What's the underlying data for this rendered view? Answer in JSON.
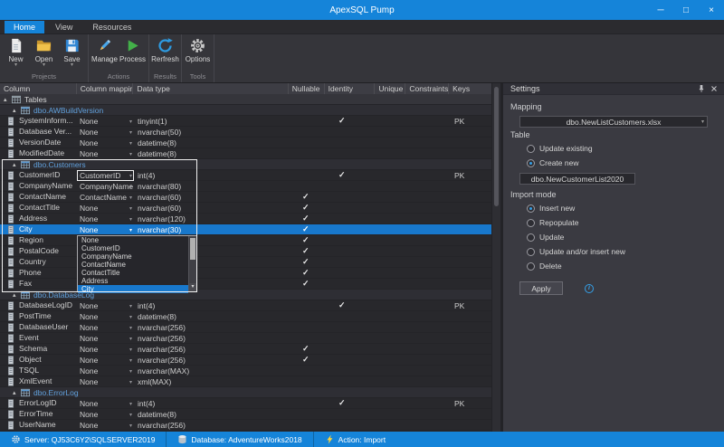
{
  "window": {
    "title": "ApexSQL Pump",
    "controls": {
      "minimize": "─",
      "maximize": "□",
      "close": "×"
    }
  },
  "tabs": [
    {
      "label": "Home",
      "active": true
    },
    {
      "label": "View",
      "active": false
    },
    {
      "label": "Resources",
      "active": false
    }
  ],
  "ribbon": {
    "groups": [
      {
        "label": "Projects",
        "items": [
          {
            "label": "New",
            "icon": "new-document-icon",
            "split": true
          },
          {
            "label": "Open",
            "icon": "open-folder-icon",
            "split": true
          },
          {
            "label": "Save",
            "icon": "save-icon",
            "split": true
          }
        ]
      },
      {
        "label": "Actions",
        "items": [
          {
            "label": "Manage",
            "icon": "manage-pencil-icon",
            "split": false
          },
          {
            "label": "Process",
            "icon": "process-play-icon",
            "split": false
          }
        ]
      },
      {
        "label": "Results",
        "items": [
          {
            "label": "Rerfresh",
            "icon": "refresh-icon",
            "split": false
          }
        ]
      },
      {
        "label": "Tools",
        "items": [
          {
            "label": "Options",
            "icon": "options-gear-icon",
            "split": false
          }
        ]
      }
    ]
  },
  "grid": {
    "columns": [
      "Column",
      "Column mapping",
      "Data type",
      "Nullable",
      "Identity",
      "Unique",
      "Constraints",
      "Keys"
    ],
    "root_label": "Tables",
    "icons": {
      "root": "tables-icon",
      "table": "table-icon",
      "column": "column-icon"
    },
    "tables": [
      {
        "name": "dbo.AWBuildVersion",
        "rows": [
          {
            "column": "SystemInform...",
            "mapping": "None",
            "datatype": "tinyint(1)",
            "nullable": false,
            "identity": true,
            "keys": "PK"
          },
          {
            "column": "Database Ver...",
            "mapping": "None",
            "datatype": "nvarchar(50)",
            "nullable": false,
            "identity": false,
            "keys": ""
          },
          {
            "column": "VersionDate",
            "mapping": "None",
            "datatype": "datetime(8)",
            "nullable": false,
            "identity": false,
            "keys": ""
          },
          {
            "column": "ModifiedDate",
            "mapping": "None",
            "datatype": "datetime(8)",
            "nullable": false,
            "identity": false,
            "keys": ""
          }
        ]
      },
      {
        "name": "dbo.Customers",
        "rows": [
          {
            "column": "CustomerID",
            "mapping": "CustomerID",
            "datatype": "int(4)",
            "nullable": false,
            "identity": true,
            "keys": "PK",
            "outlined": true
          },
          {
            "column": "CompanyName",
            "mapping": "CompanyName",
            "datatype": "nvarchar(80)",
            "nullable": false,
            "identity": false,
            "keys": ""
          },
          {
            "column": "ContactName",
            "mapping": "ContactName",
            "datatype": "nvarchar(60)",
            "nullable": true,
            "identity": false,
            "keys": ""
          },
          {
            "column": "ContactTitle",
            "mapping": "None",
            "datatype": "nvarchar(60)",
            "nullable": true,
            "identity": false,
            "keys": ""
          },
          {
            "column": "Address",
            "mapping": "None",
            "datatype": "nvarchar(120)",
            "nullable": true,
            "identity": false,
            "keys": ""
          },
          {
            "column": "City",
            "mapping": "None",
            "datatype": "nvarchar(30)",
            "nullable": true,
            "identity": false,
            "keys": "",
            "selected": true
          },
          {
            "column": "Region",
            "mapping": "",
            "datatype": "",
            "nullable": true,
            "identity": false,
            "keys": ""
          },
          {
            "column": "PostalCode",
            "mapping": "",
            "datatype": "",
            "nullable": true,
            "identity": false,
            "keys": ""
          },
          {
            "column": "Country",
            "mapping": "",
            "datatype": "",
            "nullable": true,
            "identity": false,
            "keys": ""
          },
          {
            "column": "Phone",
            "mapping": "",
            "datatype": "",
            "nullable": true,
            "identity": false,
            "keys": ""
          },
          {
            "column": "Fax",
            "mapping": "",
            "datatype": "",
            "nullable": true,
            "identity": false,
            "keys": ""
          }
        ]
      },
      {
        "name": "dbo.DatabaseLog",
        "rows": [
          {
            "column": "DatabaseLogID",
            "mapping": "None",
            "datatype": "int(4)",
            "nullable": false,
            "identity": true,
            "keys": "PK"
          },
          {
            "column": "PostTime",
            "mapping": "None",
            "datatype": "datetime(8)",
            "nullable": false,
            "identity": false,
            "keys": ""
          },
          {
            "column": "DatabaseUser",
            "mapping": "None",
            "datatype": "nvarchar(256)",
            "nullable": false,
            "identity": false,
            "keys": ""
          },
          {
            "column": "Event",
            "mapping": "None",
            "datatype": "nvarchar(256)",
            "nullable": false,
            "identity": false,
            "keys": ""
          },
          {
            "column": "Schema",
            "mapping": "None",
            "datatype": "nvarchar(256)",
            "nullable": true,
            "identity": false,
            "keys": ""
          },
          {
            "column": "Object",
            "mapping": "None",
            "datatype": "nvarchar(256)",
            "nullable": true,
            "identity": false,
            "keys": ""
          },
          {
            "column": "TSQL",
            "mapping": "None",
            "datatype": "nvarchar(MAX)",
            "nullable": false,
            "identity": false,
            "keys": ""
          },
          {
            "column": "XmlEvent",
            "mapping": "None",
            "datatype": "xml(MAX)",
            "nullable": false,
            "identity": false,
            "keys": ""
          }
        ]
      },
      {
        "name": "dbo.ErrorLog",
        "rows": [
          {
            "column": "ErrorLogID",
            "mapping": "None",
            "datatype": "int(4)",
            "nullable": false,
            "identity": true,
            "keys": "PK"
          },
          {
            "column": "ErrorTime",
            "mapping": "None",
            "datatype": "datetime(8)",
            "nullable": false,
            "identity": false,
            "keys": ""
          },
          {
            "column": "UserName",
            "mapping": "None",
            "datatype": "nvarchar(256)",
            "nullable": false,
            "identity": false,
            "keys": ""
          }
        ]
      }
    ]
  },
  "mapping_dropdown": {
    "items": [
      "None",
      "CustomerID",
      "CompanyName",
      "ContactName",
      "ContactTitle",
      "Address",
      "City"
    ],
    "selected": "City"
  },
  "settings": {
    "title": "Settings",
    "icons": {
      "pin": "pin-icon",
      "close": "close-icon"
    },
    "mapping_label": "Mapping",
    "mapping_value": "dbo.NewListCustomers.xlsx",
    "table_label": "Table",
    "table_options": [
      {
        "label": "Update existing",
        "selected": false
      },
      {
        "label": "Create new",
        "selected": true
      }
    ],
    "new_table_name": "dbo.NewCustomerList2020",
    "import_mode_label": "Import mode",
    "import_mode_options": [
      {
        "label": "Insert new",
        "selected": true
      },
      {
        "label": "Repopulate",
        "selected": false
      },
      {
        "label": "Update",
        "selected": false
      },
      {
        "label": "Update and/or insert new",
        "selected": false
      },
      {
        "label": "Delete",
        "selected": false
      }
    ],
    "apply_label": "Apply",
    "info_icon": "i"
  },
  "statusbar": {
    "icons": {
      "server": "server-gear-icon",
      "database": "database-icon",
      "action": "lightning-icon"
    },
    "server": "Server: QJ53C6Y2\\SQLSERVER2019",
    "database": "Database: AdventureWorks2018",
    "action": "Action: Import"
  },
  "colors": {
    "accent": "#1584d9",
    "selection": "#1878cc",
    "group_text": "#61a0dc"
  }
}
